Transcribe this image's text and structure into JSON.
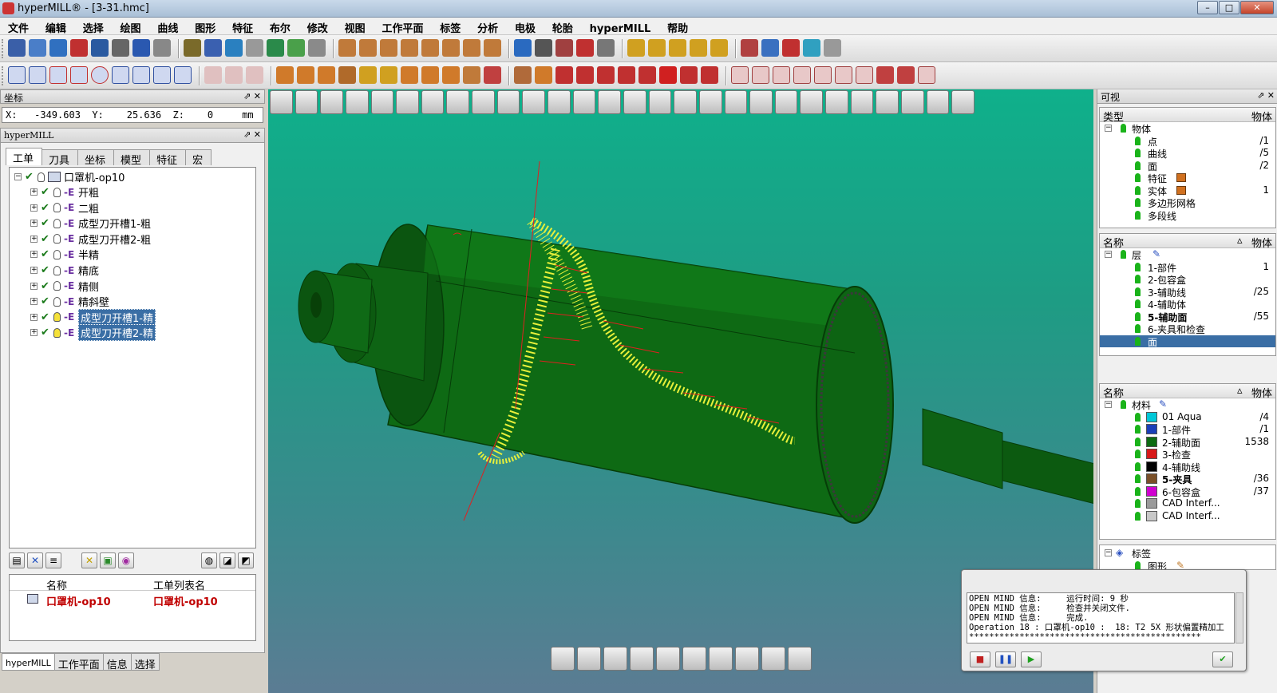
{
  "window": {
    "title": "hyperMILL® - [3-31.hmc]",
    "minimize": "–",
    "maximize": "□",
    "close": "✕"
  },
  "menu": [
    "文件",
    "编辑",
    "选择",
    "绘图",
    "曲线",
    "图形",
    "特征",
    "布尔",
    "修改",
    "视图",
    "工作平面",
    "标签",
    "分析",
    "电极",
    "轮胎",
    "hyperMILL",
    "帮助"
  ],
  "coord_panel": {
    "title": "坐标",
    "text": "X:   -349.603  Y:    25.636  Z:    0     mm"
  },
  "hypermill_panel": {
    "title": "hyperMILL",
    "tabs": [
      "工单",
      "刀具",
      "坐标",
      "模型",
      "特征",
      "宏"
    ],
    "tree": {
      "root": "口罩机-op10",
      "items": [
        {
          "label": "开粗",
          "selected": false,
          "bulb_on": false
        },
        {
          "label": "二粗",
          "selected": false,
          "bulb_on": false
        },
        {
          "label": "成型刀开槽1-粗",
          "selected": false,
          "bulb_on": false
        },
        {
          "label": "成型刀开槽2-粗",
          "selected": false,
          "bulb_on": false
        },
        {
          "label": "半精",
          "selected": false,
          "bulb_on": false
        },
        {
          "label": "精底",
          "selected": false,
          "bulb_on": false
        },
        {
          "label": "精侧",
          "selected": false,
          "bulb_on": false
        },
        {
          "label": "精斜壁",
          "selected": false,
          "bulb_on": false
        },
        {
          "label": "成型刀开槽1-精",
          "selected": true,
          "bulb_on": true
        },
        {
          "label": "成型刀开槽2-精",
          "selected": true,
          "bulb_on": true
        }
      ]
    },
    "joblist": {
      "col_name": "名称",
      "col_list": "工单列表名",
      "rows": [
        {
          "name": "口罩机-op10",
          "list": "口罩机-op10"
        }
      ]
    },
    "bottom_tabs": [
      "hyperMILL",
      "工作平面",
      "信息",
      "选择"
    ]
  },
  "right_panel": {
    "title": "可视",
    "type_box": {
      "col_type": "类型",
      "col_obj": "物体",
      "root": "物体",
      "items": [
        {
          "label": "点",
          "value": "/1"
        },
        {
          "label": "曲线",
          "value": "/5"
        },
        {
          "label": "面",
          "value": "/2"
        },
        {
          "label": "特征",
          "value": ""
        },
        {
          "label": "实体",
          "value": "1"
        },
        {
          "label": "多边形网格",
          "value": ""
        },
        {
          "label": "多段线",
          "value": ""
        }
      ]
    },
    "layer_box": {
      "col_name": "名称",
      "col_obj": "物体",
      "root": "层",
      "items": [
        {
          "label": "1-部件",
          "value": "1",
          "bold": false,
          "hl": false
        },
        {
          "label": "2-包容盒",
          "value": "",
          "bold": false,
          "hl": false
        },
        {
          "label": "3-辅助线",
          "value": "/25",
          "bold": false,
          "hl": false
        },
        {
          "label": "4-辅助体",
          "value": "",
          "bold": false,
          "hl": false
        },
        {
          "label": "5-辅助面",
          "value": "/55",
          "bold": true,
          "hl": false
        },
        {
          "label": "6-夹具和检查",
          "value": "",
          "bold": false,
          "hl": false
        },
        {
          "label": "面",
          "value": "",
          "bold": false,
          "hl": true
        }
      ]
    },
    "material_box": {
      "col_name": "名称",
      "col_obj": "物体",
      "root": "材料",
      "items": [
        {
          "label": "01 Aqua",
          "value": "/4",
          "color": "#00c8d8",
          "bold": false
        },
        {
          "label": "1-部件",
          "value": "/1",
          "color": "#1a3fb8",
          "bold": false
        },
        {
          "label": "2-辅助面",
          "value": "1538",
          "color": "#0d6b12",
          "bold": false
        },
        {
          "label": "3-检查",
          "value": "",
          "color": "#d81818",
          "bold": false
        },
        {
          "label": "4-辅助线",
          "value": "",
          "color": "#000000",
          "bold": false
        },
        {
          "label": "5-夹具",
          "value": "/36",
          "color": "#7a5028",
          "bold": true
        },
        {
          "label": "6-包容盒",
          "value": "/37",
          "color": "#d000d0",
          "bold": false
        },
        {
          "label": "CAD Interf...",
          "value": "",
          "color": "#9a9a9a",
          "bold": false
        },
        {
          "label": "CAD Interf...",
          "value": "",
          "color": "#c8c8c8",
          "bold": false
        }
      ]
    },
    "tag_box": {
      "root": "标签",
      "item": "图形"
    }
  },
  "message_window": {
    "text": "OPEN MIND 信息:     运行时间: 9 秒\nOPEN MIND 信息:     检查并关闭文件.\nOPEN MIND 信息:     完成.\nOperation 18 : 口罩机-op10 :  18: T2 5X 形状偏置精加工\n**********************************************"
  },
  "colors": {
    "viewport_top": "#0fb08b",
    "part_green": "#0d5e12",
    "toolpath_yellow": "#e8f03a",
    "toolpath_red": "#e02020"
  }
}
